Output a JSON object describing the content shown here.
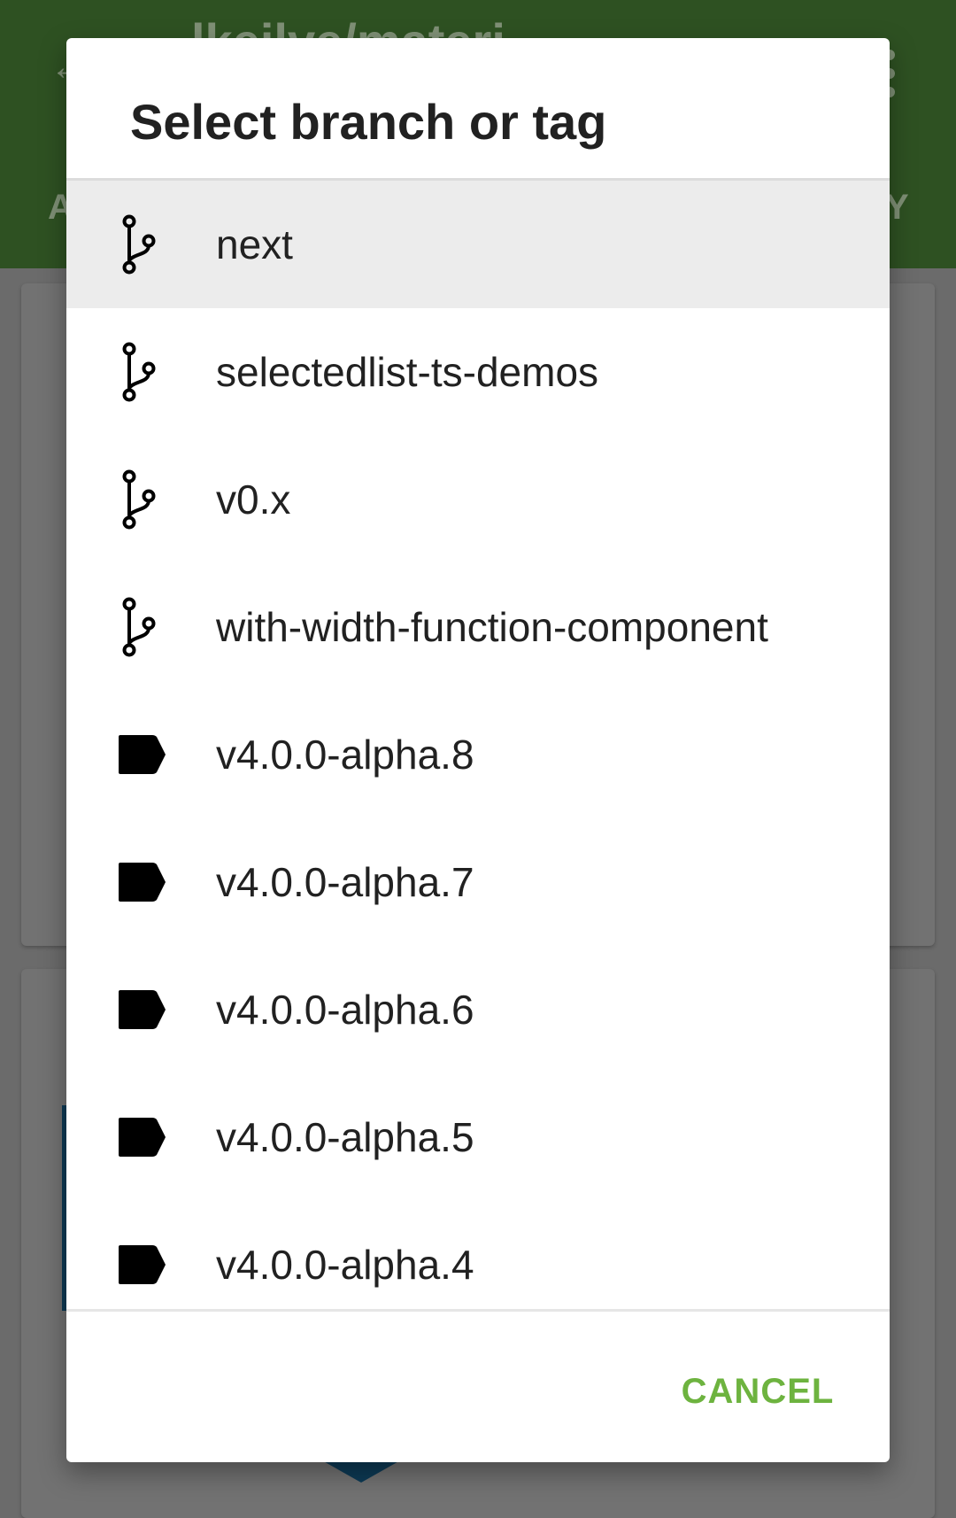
{
  "background": {
    "title": "lkeilve/materi",
    "tab_left": "A",
    "tab_right": "Y"
  },
  "dialog": {
    "title": "Select branch or tag",
    "cancel_label": "CANCEL",
    "items": [
      {
        "label": "next",
        "type": "branch",
        "icon": "git-branch-icon",
        "selected": true
      },
      {
        "label": "selectedlist-ts-demos",
        "type": "branch",
        "icon": "git-branch-icon",
        "selected": false
      },
      {
        "label": "v0.x",
        "type": "branch",
        "icon": "git-branch-icon",
        "selected": false
      },
      {
        "label": "with-width-function-component",
        "type": "branch",
        "icon": "git-branch-icon",
        "selected": false
      },
      {
        "label": "v4.0.0-alpha.8",
        "type": "tag",
        "icon": "tag-icon",
        "selected": false
      },
      {
        "label": "v4.0.0-alpha.7",
        "type": "tag",
        "icon": "tag-icon",
        "selected": false
      },
      {
        "label": "v4.0.0-alpha.6",
        "type": "tag",
        "icon": "tag-icon",
        "selected": false
      },
      {
        "label": "v4.0.0-alpha.5",
        "type": "tag",
        "icon": "tag-icon",
        "selected": false
      },
      {
        "label": "v4.0.0-alpha.4",
        "type": "tag",
        "icon": "tag-icon",
        "selected": false
      }
    ]
  },
  "colors": {
    "app_bar": "#2e5122",
    "scrim": "#6b6b6b",
    "selected_row": "#ececec",
    "accent": "#6db33f",
    "text": "#212121"
  }
}
